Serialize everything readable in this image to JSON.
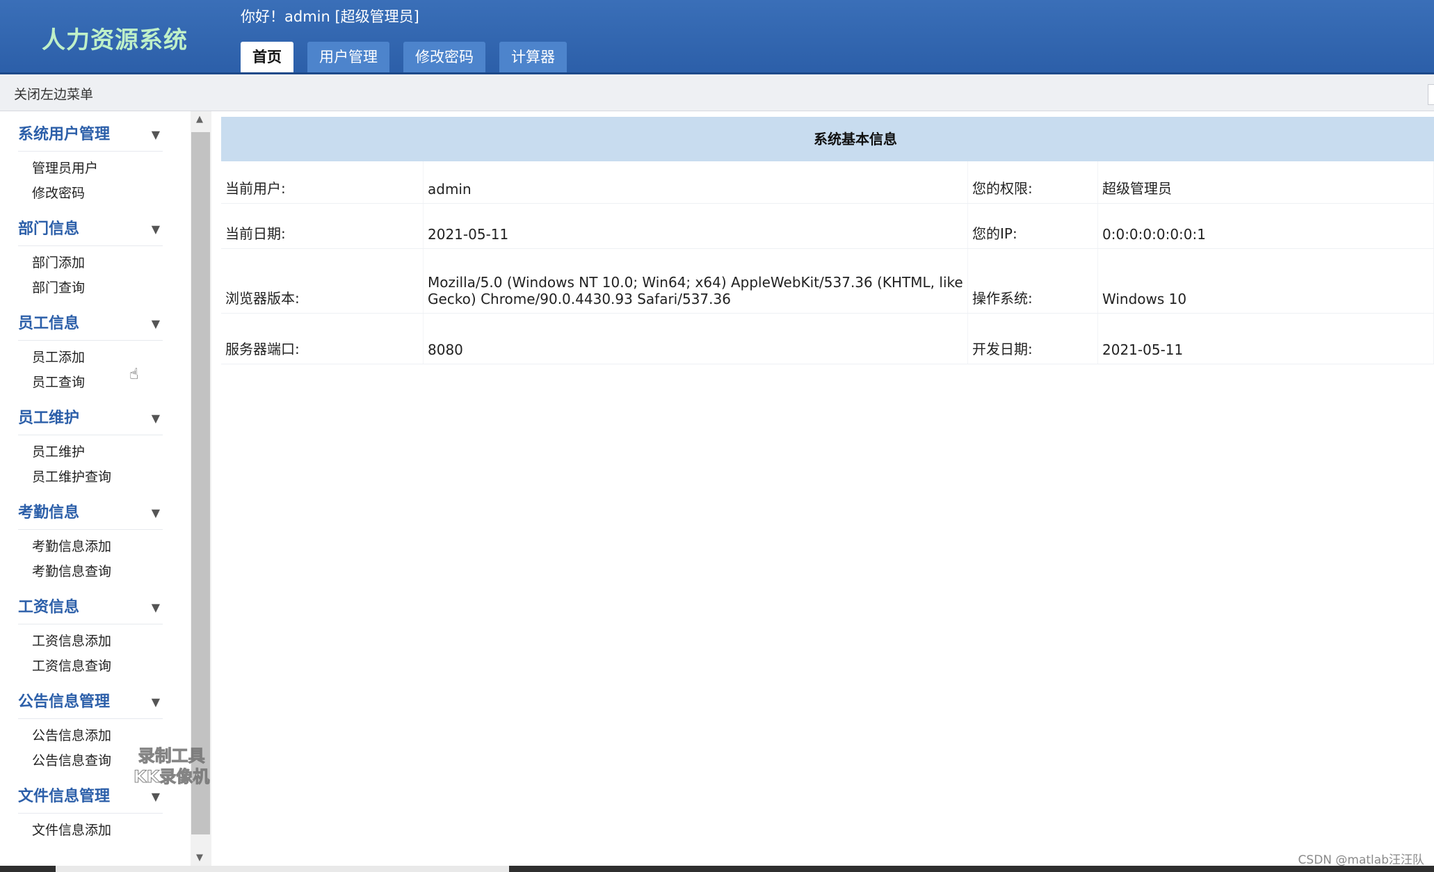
{
  "header": {
    "app_title": "人力资源系统",
    "greeting": "你好！admin [超级管理员]",
    "tabs": [
      {
        "label": "首页",
        "active": true
      },
      {
        "label": "用户管理",
        "active": false
      },
      {
        "label": "修改密码",
        "active": false
      },
      {
        "label": "计算器",
        "active": false
      }
    ]
  },
  "toolbar": {
    "toggle_menu_label": "关闭左边菜单"
  },
  "sidebar": {
    "groups": [
      {
        "title": "系统用户管理",
        "items": [
          "管理员用户",
          "修改密码"
        ]
      },
      {
        "title": "部门信息",
        "items": [
          "部门添加",
          "部门查询"
        ]
      },
      {
        "title": "员工信息",
        "items": [
          "员工添加",
          "员工查询"
        ]
      },
      {
        "title": "员工维护",
        "items": [
          "员工维护",
          "员工维护查询"
        ]
      },
      {
        "title": "考勤信息",
        "items": [
          "考勤信息添加",
          "考勤信息查询"
        ]
      },
      {
        "title": "工资信息",
        "items": [
          "工资信息添加",
          "工资信息查询"
        ]
      },
      {
        "title": "公告信息管理",
        "items": [
          "公告信息添加",
          "公告信息查询"
        ]
      },
      {
        "title": "文件信息管理",
        "items": [
          "文件信息添加"
        ]
      }
    ],
    "watermark_line1": "录制工具",
    "watermark_line2": "KK录像机"
  },
  "main": {
    "panel_title": "系统基本信息",
    "rows": [
      {
        "label1": "当前用户:",
        "value1": "admin",
        "label2": "您的权限:",
        "value2": "超级管理员"
      },
      {
        "label1": "当前日期:",
        "value1": "2021-05-11",
        "label2": "您的IP:",
        "value2": "0:0:0:0:0:0:0:1"
      },
      {
        "label1": "浏览器版本:",
        "value1": "Mozilla/5.0 (Windows NT 10.0; Win64; x64) AppleWebKit/537.36 (KHTML, like Gecko) Chrome/90.0.4430.93 Safari/537.36",
        "label2": "操作系统:",
        "value2": "Windows 10"
      },
      {
        "label1": "服务器端口:",
        "value1": "8080",
        "label2": "开发日期:",
        "value2": "2021-05-11"
      }
    ]
  },
  "footer": {
    "credit": "CSDN @matlab汪汪队"
  }
}
